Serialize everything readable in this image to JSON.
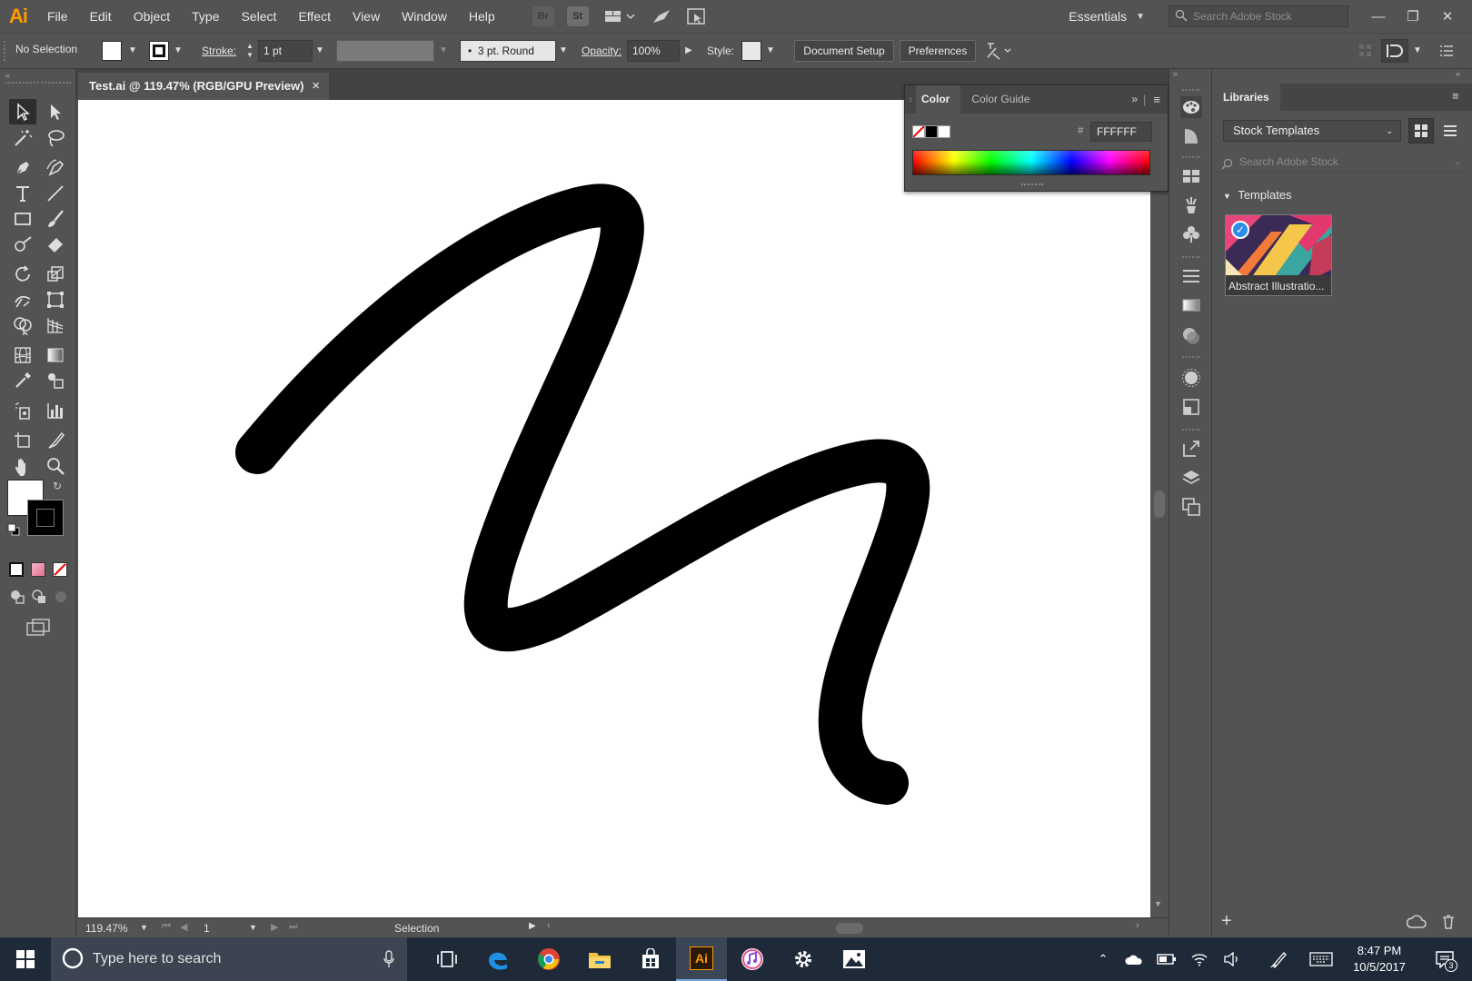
{
  "app": {
    "logo": "Ai",
    "menu": [
      "File",
      "Edit",
      "Object",
      "Type",
      "Select",
      "Effect",
      "View",
      "Window",
      "Help"
    ],
    "bridge_icon": "Br",
    "stock_icon": "St",
    "workspace": "Essentials",
    "stock_search_placeholder": "Search Adobe Stock"
  },
  "control_bar": {
    "selection": "No Selection",
    "stroke_label": "Stroke:",
    "stroke_value": "1 pt",
    "brush": "3 pt. Round",
    "opacity_label": "Opacity:",
    "opacity_value": "100%",
    "style_label": "Style:",
    "document_setup": "Document Setup",
    "preferences": "Preferences"
  },
  "document": {
    "tab_title": "Test.ai @ 119.47% (RGB/GPU Preview)",
    "close_glyph": "×"
  },
  "status_bar": {
    "zoom": "119.47%",
    "artboard": "1",
    "tool": "Selection"
  },
  "color_panel": {
    "tabs": [
      "Color",
      "Color Guide"
    ],
    "hex_label": "#",
    "hex_value": "FFFFFF"
  },
  "libraries": {
    "tab": "Libraries",
    "library_select": "Stock Templates",
    "search_placeholder": "Search Adobe Stock",
    "section": "Templates",
    "template_label": "Abstract Illustratio..."
  },
  "taskbar": {
    "search_placeholder": "Type here to search",
    "time": "8:47 PM",
    "date": "10/5/2017",
    "notifications_count": "3",
    "apps": [
      "task-view-icon",
      "edge-icon",
      "chrome-icon",
      "file-explorer-icon",
      "store-icon",
      "illustrator-icon",
      "itunes-icon",
      "settings-icon",
      "photos-icon"
    ]
  },
  "colors": {
    "ui_bg": "#535353",
    "canvas": "#ffffff",
    "brand_orange": "#ff9a00",
    "taskbar": "#1f2a38",
    "stroke": "#000000"
  }
}
